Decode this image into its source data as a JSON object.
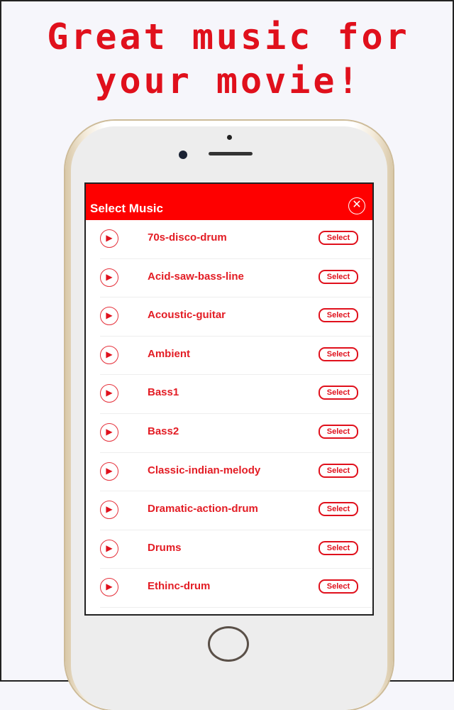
{
  "headline": {
    "line1": "Great music for",
    "line2": "your movie!"
  },
  "dialog": {
    "title": "Select Music",
    "close_icon": "close-circle-icon",
    "select_label": "Select",
    "tracks": [
      "70s-disco-drum",
      "Acid-saw-bass-line",
      "Acoustic-guitar",
      "Ambient",
      "Bass1",
      "Bass2",
      "Classic-indian-melody",
      "Dramatic-action-drum",
      "Drums",
      "Ethinc-drum"
    ]
  },
  "colors": {
    "accent": "#fe0000",
    "text": "#e31c24"
  }
}
